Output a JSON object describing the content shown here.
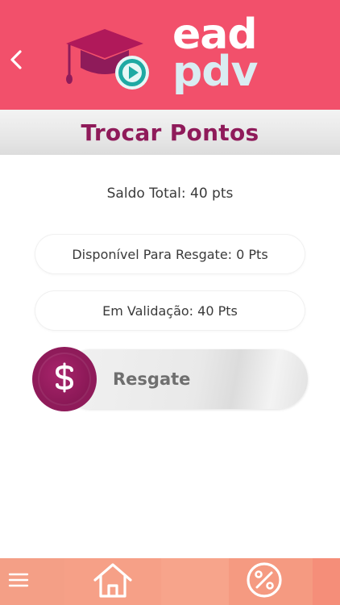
{
  "header": {
    "back_icon": "chevron-left-icon",
    "logo": {
      "line1": "ead",
      "line2": "pdv",
      "icons": [
        "graduation-cap-icon",
        "play-icon"
      ]
    },
    "colors": {
      "background": "#f2506b",
      "logo_primary": "#ffffff",
      "logo_secondary": "#d9ecf2",
      "teal": "#1fa9a3"
    }
  },
  "page": {
    "title": "Trocar Pontos",
    "title_color": "#8f1b5a"
  },
  "points": {
    "saldo_total": "Saldo Total: 40 pts",
    "disponivel": "Disponível Para Resgate: 0 Pts",
    "em_validacao": "Em Validação: 40 Pts"
  },
  "resgate": {
    "label": "Resgate",
    "icon": "dollar-icon",
    "color": "#8f1b5a"
  },
  "bottom_nav": {
    "items": [
      {
        "icon": "menu-icon"
      },
      {
        "icon": "home-icon"
      },
      {
        "icon": "percent-icon"
      }
    ],
    "color": "#f78c78"
  }
}
